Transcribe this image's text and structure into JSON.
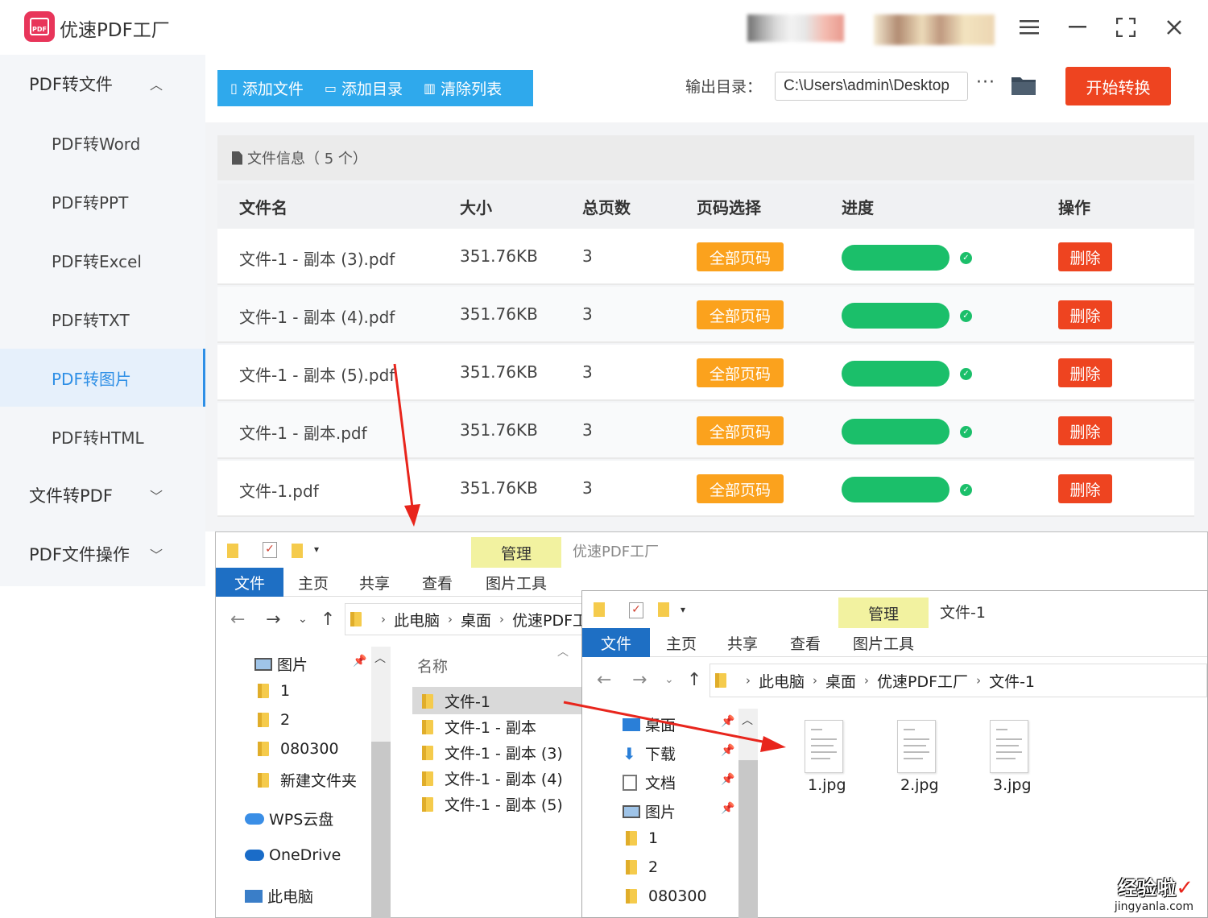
{
  "app": {
    "title": "优速PDF工厂",
    "logo_text": "PDF",
    "accent_color": "#2fa9ec",
    "danger_color": "#ee4420",
    "success_color": "#1bbf6a",
    "warning_color": "#fba21d"
  },
  "window_controls": {
    "menu_icon": "menu-icon",
    "minimize_icon": "minimize-icon",
    "fullscreen_icon": "fullscreen-icon",
    "close_icon": "close-icon"
  },
  "sidebar": {
    "groups": [
      {
        "label": "PDF转文件",
        "expanded": true
      },
      {
        "label": "文件转PDF",
        "expanded": false
      },
      {
        "label": "PDF文件操作",
        "expanded": false
      }
    ],
    "items": [
      {
        "label": "PDF转Word"
      },
      {
        "label": "PDF转PPT"
      },
      {
        "label": "PDF转Excel"
      },
      {
        "label": "PDF转TXT"
      },
      {
        "label": "PDF转图片",
        "active": true
      },
      {
        "label": "PDF转HTML"
      }
    ]
  },
  "toolbar": {
    "add_file": "添加文件",
    "add_dir": "添加目录",
    "clear_list": "清除列表",
    "output_label": "输出目录：",
    "output_path": "C:\\Users\\admin\\Desktop",
    "more": "···",
    "start": "开始转换"
  },
  "file_info": {
    "label": "文件信息",
    "count": "（ 5 个）"
  },
  "table": {
    "headers": [
      "文件名",
      "大小",
      "总页数",
      "页码选择",
      "进度",
      "操作"
    ],
    "rows": [
      {
        "name": "文件-1 - 副本 (3).pdf",
        "size": "351.76KB",
        "pages": "3",
        "page_select": "全部页码",
        "progress": 1.0,
        "action": "删除"
      },
      {
        "name": "文件-1 - 副本 (4).pdf",
        "size": "351.76KB",
        "pages": "3",
        "page_select": "全部页码",
        "progress": 1.0,
        "action": "删除"
      },
      {
        "name": "文件-1 - 副本 (5).pdf",
        "size": "351.76KB",
        "pages": "3",
        "page_select": "全部页码",
        "progress": 1.0,
        "action": "删除"
      },
      {
        "name": "文件-1 - 副本.pdf",
        "size": "351.76KB",
        "pages": "3",
        "page_select": "全部页码",
        "progress": 1.0,
        "action": "删除"
      },
      {
        "name": "文件-1.pdf",
        "size": "351.76KB",
        "pages": "3",
        "page_select": "全部页码",
        "progress": 1.0,
        "action": "删除"
      }
    ]
  },
  "explorer1": {
    "title": "优速PDF工厂",
    "manage": "管理",
    "tabs": [
      "文件",
      "主页",
      "共享",
      "查看",
      "图片工具"
    ],
    "path": [
      "此电脑",
      "桌面",
      "优速PDF工厂"
    ],
    "tree": [
      "图片",
      "1",
      "2",
      "080300",
      "新建文件夹",
      "WPS云盘",
      "OneDrive",
      "此电脑"
    ],
    "column_name": "名称",
    "files": [
      "文件-1",
      "文件-1 - 副本",
      "文件-1 - 副本 (3)",
      "文件-1 - 副本 (4)",
      "文件-1 - 副本 (5)"
    ]
  },
  "explorer2": {
    "title": "文件-1",
    "manage": "管理",
    "tabs": [
      "文件",
      "主页",
      "共享",
      "查看",
      "图片工具"
    ],
    "path": [
      "此电脑",
      "桌面",
      "优速PDF工厂",
      "文件-1"
    ],
    "tree": [
      "桌面",
      "下载",
      "文档",
      "图片",
      "1",
      "2",
      "080300"
    ],
    "files": [
      "1.jpg",
      "2.jpg",
      "3.jpg"
    ]
  },
  "watermark": {
    "line1": "经验啦",
    "check": "✓",
    "line2": "jingyanla.com"
  }
}
